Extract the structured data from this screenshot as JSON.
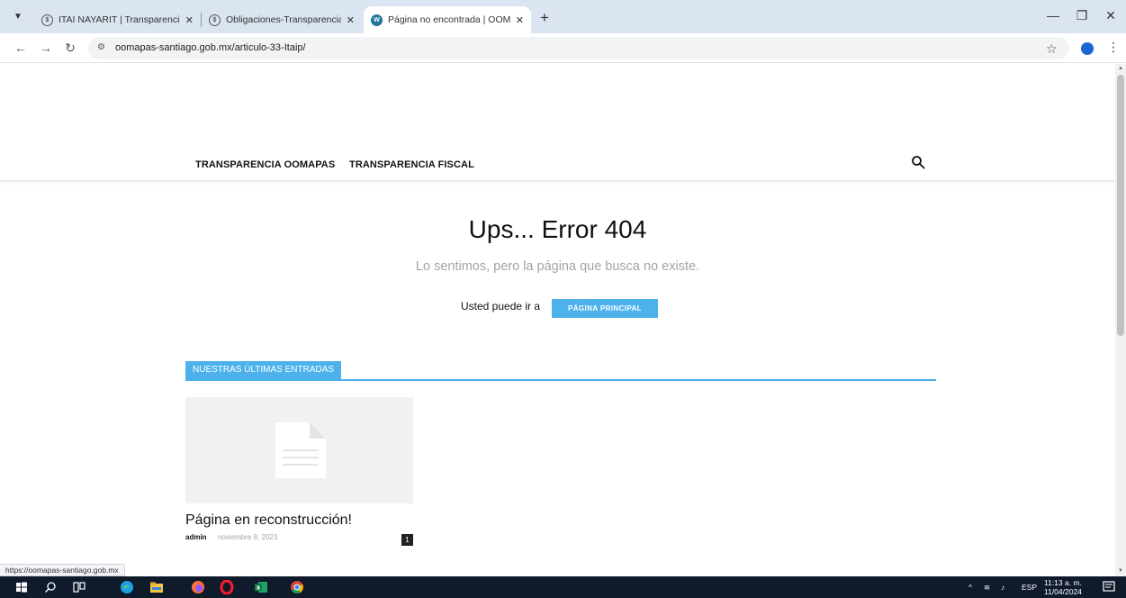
{
  "browser": {
    "tabs": [
      {
        "title": "ITAI NAYARIT | Transparencia",
        "favicon": "itai-favicon-icon",
        "active": false
      },
      {
        "title": "Obligaciones-Transparencia | IT",
        "favicon": "itai-favicon-icon",
        "active": false
      },
      {
        "title": "Página no encontrada | OOMAP",
        "favicon": "wordpress-icon",
        "active": true
      }
    ],
    "url": "oomapas-santiago.gob.mx/articulo-33-Itaip/",
    "status_url": "https://oomapas-santiago.gob.mx"
  },
  "site": {
    "menu": [
      "TRANSPARENCIA OOMAPAS",
      "TRANSPARENCIA FISCAL"
    ],
    "accent_color": "#4db2ec"
  },
  "error": {
    "title": "Ups... Error 404",
    "subtitle": "Lo sentimos, pero la página que busca no existe.",
    "goto_text": "Usted puede ir a",
    "home_button": "PÁGINA PRINCIPAL"
  },
  "latest": {
    "heading": "NUESTRAS ÚLTIMAS ENTRADAS",
    "post": {
      "title": "Página en reconstrucción!",
      "author": "admin",
      "date": "noviembre 8, 2023",
      "comments": "1"
    }
  },
  "taskbar": {
    "language": "ESP",
    "time": "11:13 a. m.",
    "date": "11/04/2024"
  }
}
